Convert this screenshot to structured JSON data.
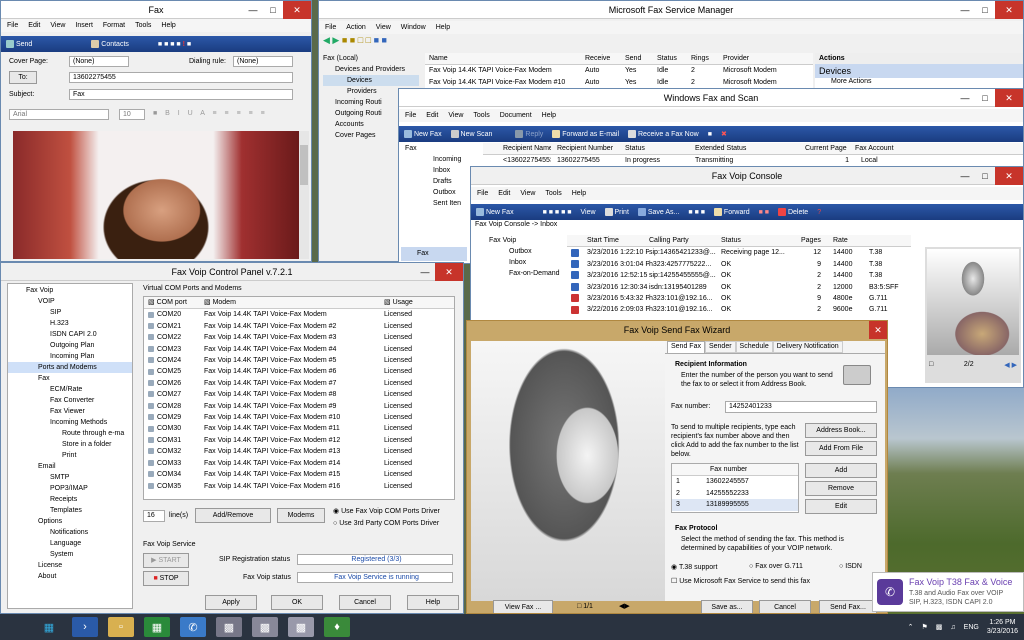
{
  "fax_compose": {
    "title": "Fax",
    "menu": [
      "File",
      "Edit",
      "View",
      "Insert",
      "Format",
      "Tools",
      "Help"
    ],
    "toolbar": {
      "send": "Send",
      "contacts": "Contacts"
    },
    "cover_page_label": "Cover Page:",
    "cover_page_value": "(None)",
    "dialing_rule_label": "Dialing rule:",
    "dialing_rule_value": "(None)",
    "to_label": "To:",
    "to_value": "13602275455",
    "subject_label": "Subject:",
    "subject_value": "Fax",
    "font_value": "Arial",
    "size_value": "10"
  },
  "fsm": {
    "title": "Microsoft Fax Service Manager",
    "menu": [
      "File",
      "Action",
      "View",
      "Window",
      "Help"
    ],
    "tree": [
      "Fax (Local)",
      "Devices and Providers",
      "Devices",
      "Providers",
      "Incoming Routi",
      "Outgoing Routi",
      "Accounts",
      "Cover Pages"
    ],
    "columns": [
      "Name",
      "Receive",
      "Send",
      "Status",
      "Rings",
      "Provider"
    ],
    "rows": [
      [
        "Fax Voip 14.4K TAPI Voice-Fax Modem",
        "Auto",
        "Yes",
        "Idle",
        "2",
        "Microsoft Modem"
      ],
      [
        "Fax Voip 14.4K TAPI Voice-Fax Modem #10",
        "Auto",
        "Yes",
        "Idle",
        "2",
        "Microsoft Modem"
      ]
    ],
    "actions_title": "Actions",
    "actions_item": "Devices",
    "actions_more": "More Actions"
  },
  "wfs": {
    "title": "Windows Fax and Scan",
    "menu": [
      "File",
      "Edit",
      "View",
      "Tools",
      "Document",
      "Help"
    ],
    "toolbar": [
      "New Fax",
      "New Scan",
      "Reply",
      "Forward as E-mail",
      "Receive a Fax Now"
    ],
    "tree": [
      "Fax",
      "Incoming",
      "Inbox",
      "Drafts",
      "Outbox",
      "Sent Iten"
    ],
    "columns": [
      "Recipient Name",
      "Recipient Number",
      "Status",
      "Extended Status",
      "Current Page",
      "Fax Account"
    ],
    "row": [
      "<13602275455>",
      "13602275455",
      "In progress",
      "Transmitting",
      "1",
      "Local"
    ],
    "bottom_tab": "Fax"
  },
  "console": {
    "title": "Fax Voip Console",
    "menu": [
      "File",
      "Edit",
      "View",
      "Tools",
      "Help"
    ],
    "toolbar": [
      "New Fax",
      "View",
      "Print",
      "Save As...",
      "Forward",
      "Delete"
    ],
    "breadcrumb": "Fax Voip Console -> Inbox",
    "tree": [
      "Fax Voip",
      "Outbox",
      "Inbox",
      "Fax-on-Demand"
    ],
    "columns": [
      "Start Time",
      "Calling Party",
      "Status",
      "Pages",
      "Rate",
      ""
    ],
    "rows": [
      [
        "3/23/2016 1:22:10 PM",
        "sip:14365421233@...",
        "Receiving page 12...",
        "12",
        "14400",
        "T.38"
      ],
      [
        "3/23/2016 3:01:04 PM",
        "h323:4257775222...",
        "OK",
        "9",
        "14400",
        "T.38"
      ],
      [
        "3/23/2016 12:52:15 PM",
        "sip:14255455555@...",
        "OK",
        "2",
        "14400",
        "T.38"
      ],
      [
        "3/23/2016 12:30:34 PM",
        "isdn:13195401289",
        "OK",
        "2",
        "12000",
        "B3:5:SFF"
      ],
      [
        "3/23/2016 5:43:32 PM",
        "h323:101@192.16...",
        "OK",
        "9",
        "4800e",
        "G.711"
      ],
      [
        "3/22/2016 2:09:03 PM",
        "h323:101@192.16...",
        "OK",
        "2",
        "9600e",
        "G.711"
      ]
    ],
    "preview_page": "2/2"
  },
  "control": {
    "title": "Fax Voip Control Panel v.7.2.1",
    "tree": [
      "Fax Voip",
      "VOIP",
      "SIP",
      "H.323",
      "ISDN CAPI 2.0",
      "Outgoing Plan",
      "Incoming Plan",
      "Ports and Modems",
      "Fax",
      "ECM/Rate",
      "Fax Converter",
      "Fax Viewer",
      "Incoming Methods",
      "Route through e-ma",
      "Store in a folder",
      "Print",
      "Email",
      "SMTP",
      "POP3/IMAP",
      "Receipts",
      "Templates",
      "Options",
      "Notifications",
      "Language",
      "System",
      "License",
      "About"
    ],
    "group_title": "Virtual COM Ports and Modems",
    "col_port": "COM port",
    "col_modem": "Modem",
    "col_usage": "Usage",
    "ports": [
      [
        "COM20",
        "Fax Voip 14.4K TAPI Voice-Fax Modem",
        "Licensed"
      ],
      [
        "COM21",
        "Fax Voip 14.4K TAPI Voice-Fax Modem #2",
        "Licensed"
      ],
      [
        "COM22",
        "Fax Voip 14.4K TAPI Voice-Fax Modem #3",
        "Licensed"
      ],
      [
        "COM23",
        "Fax Voip 14.4K TAPI Voice-Fax Modem #4",
        "Licensed"
      ],
      [
        "COM24",
        "Fax Voip 14.4K TAPI Voice-Fax Modem #5",
        "Licensed"
      ],
      [
        "COM25",
        "Fax Voip 14.4K TAPI Voice-Fax Modem #6",
        "Licensed"
      ],
      [
        "COM26",
        "Fax Voip 14.4K TAPI Voice-Fax Modem #7",
        "Licensed"
      ],
      [
        "COM27",
        "Fax Voip 14.4K TAPI Voice-Fax Modem #8",
        "Licensed"
      ],
      [
        "COM28",
        "Fax Voip 14.4K TAPI Voice-Fax Modem #9",
        "Licensed"
      ],
      [
        "COM29",
        "Fax Voip 14.4K TAPI Voice-Fax Modem #10",
        "Licensed"
      ],
      [
        "COM30",
        "Fax Voip 14.4K TAPI Voice-Fax Modem #11",
        "Licensed"
      ],
      [
        "COM31",
        "Fax Voip 14.4K TAPI Voice-Fax Modem #12",
        "Licensed"
      ],
      [
        "COM32",
        "Fax Voip 14.4K TAPI Voice-Fax Modem #13",
        "Licensed"
      ],
      [
        "COM33",
        "Fax Voip 14.4K TAPI Voice-Fax Modem #14",
        "Licensed"
      ],
      [
        "COM34",
        "Fax Voip 14.4K TAPI Voice-Fax Modem #15",
        "Licensed"
      ],
      [
        "COM35",
        "Fax Voip 14.4K TAPI Voice-Fax Modem #16",
        "Licensed"
      ]
    ],
    "lines_value": "16",
    "lines_label": "line(s)",
    "add_remove": "Add/Remove",
    "modems": "Modems",
    "radio_use": "Use Fax Voip COM Ports Driver",
    "radio_3rd": "Use 3rd Party COM Ports Driver",
    "service_title": "Fax Voip Service",
    "start": "START",
    "stop": "STOP",
    "sip_label": "SIP Registration status",
    "sip_value": "Registered (3/3)",
    "status_label": "Fax Voip status",
    "status_value": "Fax Voip Service is running",
    "apply": "Apply",
    "ok": "OK",
    "cancel": "Cancel",
    "help": "Help"
  },
  "wizard": {
    "title": "Fax Voip Send Fax Wizard",
    "tabs": [
      "Send Fax",
      "Sender",
      "Schedule",
      "Delivery Notification"
    ],
    "recipient_title": "Recipient Information",
    "recipient_desc": "Enter the number of the person you want to send the fax to or select it from Address Book.",
    "fax_number_label": "Fax number:",
    "fax_number_value": "14252401233",
    "multi_desc": "To send to multiple recipients, type each recipient's fax number above and then click Add to add the fax number to the list below.",
    "address_book": "Address Book...",
    "add_from_file": "Add From File",
    "add": "Add",
    "remove": "Remove",
    "edit": "Edit",
    "list_header": "Fax number",
    "numbers": [
      [
        "1",
        "13602245557"
      ],
      [
        "2",
        "14255552233"
      ],
      [
        "3",
        "13189995555"
      ]
    ],
    "protocol_title": "Fax Protocol",
    "protocol_desc": "Select the method of sending the fax. This method is determined by capabilities of your VOIP network.",
    "opt_t38": "T.38 support",
    "opt_g711": "Fax over G.711",
    "opt_isdn": "ISDN",
    "use_ms": "Use Microsoft Fax Service to send this fax",
    "view_fax": "View Fax ...",
    "page": "1/1",
    "save_as": "Save as...",
    "cancel": "Cancel",
    "send_fax": "Send Fax..."
  },
  "notification": {
    "title": "Fax Voip T38 Fax & Voice",
    "line1": "T.38 and Audio Fax over VOIP",
    "line2": "SIP, H.323, ISDN CAPI 2.0"
  },
  "taskbar": {
    "lang": "ENG",
    "time": "1:26 PM",
    "date": "3/23/2016"
  },
  "colors": {
    "toolbar_blue": "#1e4590",
    "wizard_title": "#c9a86a",
    "accent": "#3a6cc0"
  }
}
